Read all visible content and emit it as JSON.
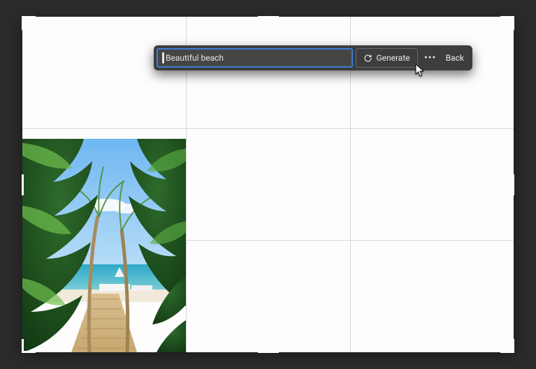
{
  "taskbar": {
    "prompt_value": "Beautiful beach",
    "generate_label": "Generate",
    "more_label": "•••",
    "back_label": "Back"
  },
  "icons": {
    "generate": "regenerate-icon",
    "more": "more-icon",
    "pointer": "cursor-pointer-icon"
  },
  "colors": {
    "focus_ring": "#3b7dd8",
    "taskbar_bg": "#3d3d3d",
    "canvas_bg": "#fdfdfd",
    "app_bg": "#2b2b2b"
  }
}
